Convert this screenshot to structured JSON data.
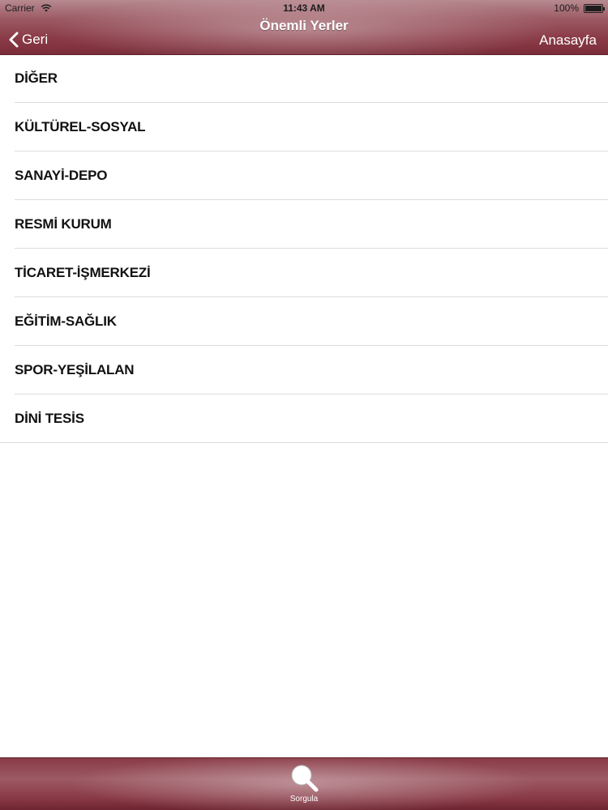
{
  "status_bar": {
    "carrier": "Carrier",
    "time": "11:43 AM",
    "battery": "100%"
  },
  "nav": {
    "title": "Önemli Yerler",
    "back_label": "Geri",
    "home_label": "Anasayfa"
  },
  "categories": [
    {
      "label": "DİĞER"
    },
    {
      "label": "KÜLTÜREL-SOSYAL"
    },
    {
      "label": "SANAYİ-DEPO"
    },
    {
      "label": "RESMİ KURUM"
    },
    {
      "label": "TİCARET-İŞMERKEZİ"
    },
    {
      "label": "EĞİTİM-SAĞLIK"
    },
    {
      "label": "SPOR-YEŞİLALAN"
    },
    {
      "label": "DİNİ TESİS"
    }
  ],
  "tabbar": {
    "tabs": [
      {
        "label": "Sorgula",
        "icon": "magnifier-icon"
      }
    ]
  },
  "colors": {
    "bar_primary": "#8a3b47",
    "bar_highlight": "#b78a90",
    "text_on_bar": "#ffffff",
    "list_text": "#111111",
    "separator": "#dcdcdc"
  }
}
